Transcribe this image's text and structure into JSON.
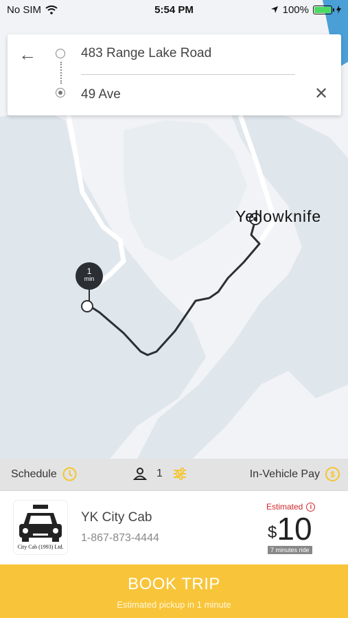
{
  "status_bar": {
    "carrier": "No SIM",
    "time": "5:54 PM",
    "battery": "100%"
  },
  "route": {
    "origin": "483 Range Lake Road",
    "destination": "49 Ave"
  },
  "map": {
    "city_label": "Yellowknife",
    "eta_value": "1",
    "eta_unit": "min"
  },
  "options": {
    "schedule_label": "Schedule",
    "passenger_count": "1",
    "payment_label": "In-Vehicle Pay"
  },
  "provider": {
    "name": "YK City Cab",
    "phone": "1-867-873-4444",
    "logo_caption": "City Cab (1993) Ltd.",
    "estimate_label": "Estimated",
    "currency": "$",
    "price": "10",
    "duration": "7 minutes ride"
  },
  "book": {
    "title": "BOOK TRIP",
    "subtitle": "Estimated pickup in 1 minute"
  },
  "colors": {
    "accent": "#f8c53a",
    "estimate": "#d0252c",
    "water": "#dfe6ec",
    "land": "#f1f3f6"
  }
}
